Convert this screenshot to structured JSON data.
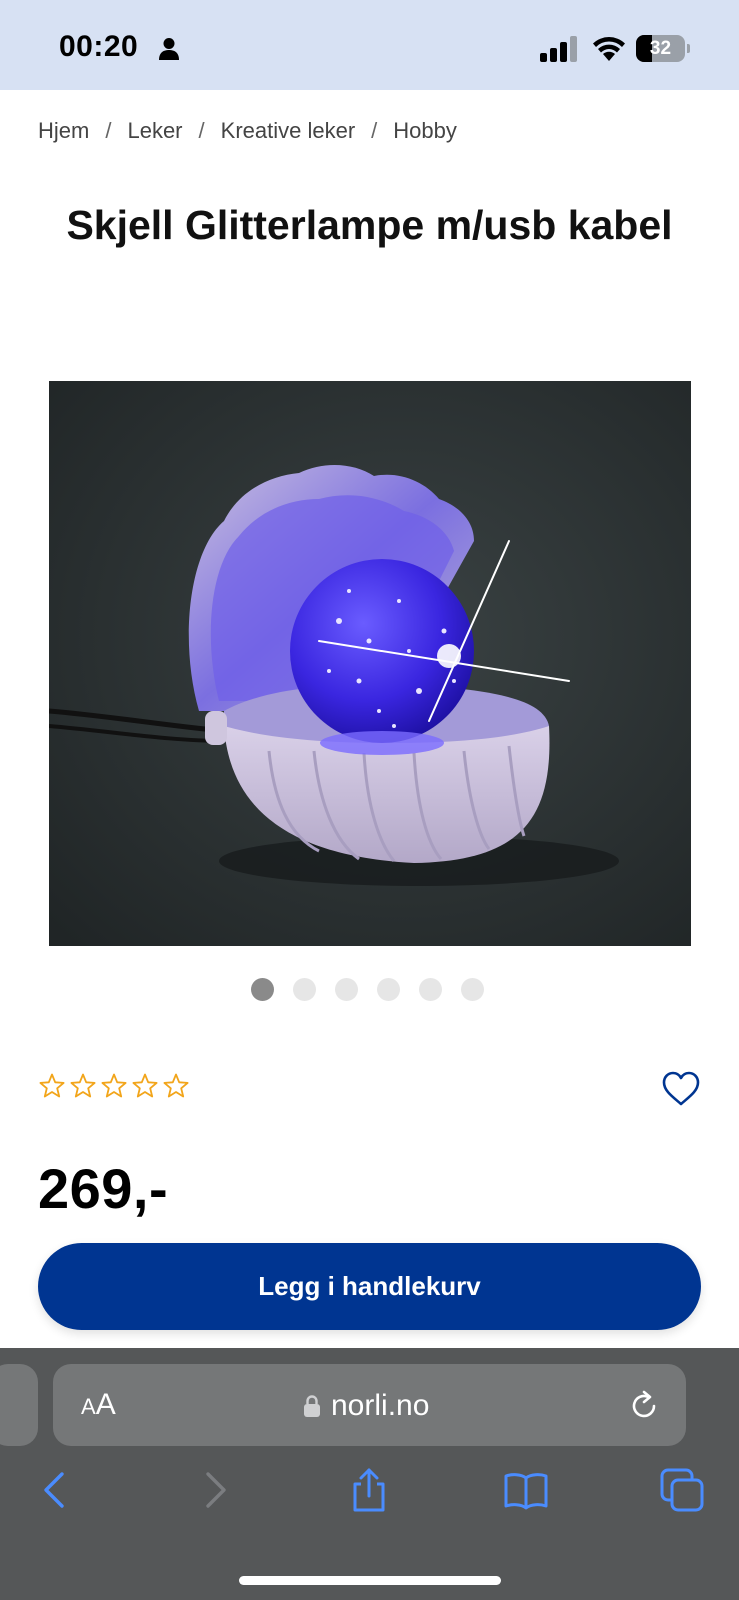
{
  "status_bar": {
    "time": "00:20",
    "battery": "32",
    "battery_level": 0.32
  },
  "breadcrumb": {
    "items": [
      "Hjem",
      "Leker",
      "Kreative leker",
      "Hobby"
    ],
    "separator": "/"
  },
  "product": {
    "title": "Skjell Glitterlampe m/usb kabel",
    "image_alt": "product-photo-shell-glitter-lamp",
    "carousel": {
      "count": 6,
      "active_index": 0
    },
    "rating": {
      "stars": 0,
      "max": 5
    },
    "price": "269,-",
    "add_to_cart_label": "Legg i handlekurv"
  },
  "browser": {
    "text_size_small": "A",
    "text_size_big": "A",
    "url": "norli.no",
    "toolbar_icons": [
      "back-icon",
      "forward-icon",
      "share-icon",
      "bookmarks-icon",
      "tabs-icon"
    ]
  },
  "colors": {
    "status_bar_bg": "#d7e1f3",
    "brand_blue": "#003591",
    "star": "#f2a51a",
    "heart": "#003591",
    "safari_accent": "#4a8cff"
  }
}
